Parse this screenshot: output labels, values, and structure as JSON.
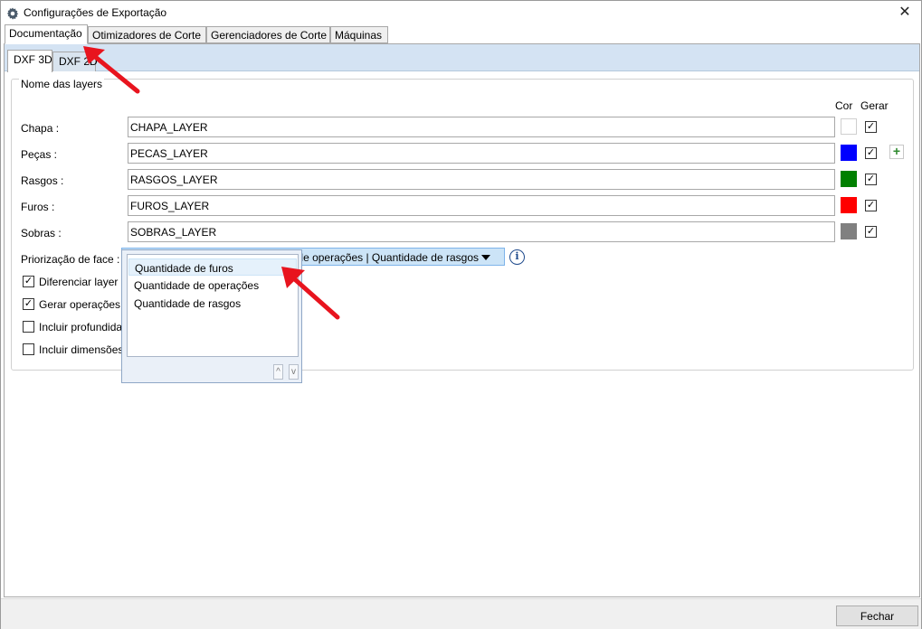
{
  "window": {
    "title": "Configurações de Exportação",
    "title_icon": "gear-icon",
    "close_glyph": "✕"
  },
  "top_tabs": [
    "Documentação",
    "Otimizadores de Corte",
    "Gerenciadores de Corte",
    "Máquinas"
  ],
  "sub_tabs": [
    "DXF 3D",
    "DXF 2D"
  ],
  "layers_group": {
    "title": "Nome das layers",
    "col_cor": "Cor",
    "col_gerar": "Gerar",
    "rows": [
      {
        "label": "Chapa :",
        "value": "CHAPA_LAYER",
        "color": "#ffffff",
        "gerar": true
      },
      {
        "label": "Peças :",
        "value": "PECAS_LAYER",
        "color": "#0000ff",
        "gerar": true
      },
      {
        "label": "Rasgos :",
        "value": "RASGOS_LAYER",
        "color": "#008000",
        "gerar": true
      },
      {
        "label": "Furos :",
        "value": "FUROS_LAYER",
        "color": "#ff0000",
        "gerar": true
      },
      {
        "label": "Sobras :",
        "value": "SOBRAS_LAYER",
        "color": "#808080",
        "gerar": true
      }
    ],
    "priorizacao_label": "Priorização de face :",
    "priorizacao_value": "de operações | Quantidade de rasgos",
    "options": [
      {
        "label": "Diferenciar layer c",
        "checked": true
      },
      {
        "label": "Gerar operações c",
        "checked": true
      },
      {
        "label": "Incluir profundida",
        "checked": false
      },
      {
        "label": "Incluir dimensões",
        "checked": false
      }
    ]
  },
  "dropdown": {
    "items": [
      "Quantidade de furos",
      "Quantidade de operações",
      "Quantidade de rasgos"
    ],
    "up_glyph": "^",
    "down_glyph": "v"
  },
  "footer": {
    "fechar_label": "Fechar"
  },
  "annotation_color": "#e8141e"
}
